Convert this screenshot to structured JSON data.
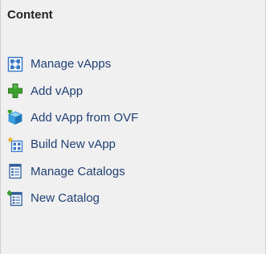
{
  "panel": {
    "title": "Content",
    "items": [
      {
        "label": "Manage vApps",
        "icon": "manage-vapps-icon"
      },
      {
        "label": "Add vApp",
        "icon": "green-plus-icon"
      },
      {
        "label": "Add vApp from OVF",
        "icon": "ovf-box-icon"
      },
      {
        "label": "Build New vApp",
        "icon": "build-vapp-icon"
      },
      {
        "label": "Manage Catalogs",
        "icon": "catalog-icon"
      },
      {
        "label": "New Catalog",
        "icon": "new-catalog-icon"
      }
    ]
  },
  "colors": {
    "background": "#f0f0f0",
    "link_text": "#1f3f73",
    "title_text": "#222222",
    "accent_blue": "#3a78c8",
    "accent_green": "#3aa12e"
  }
}
